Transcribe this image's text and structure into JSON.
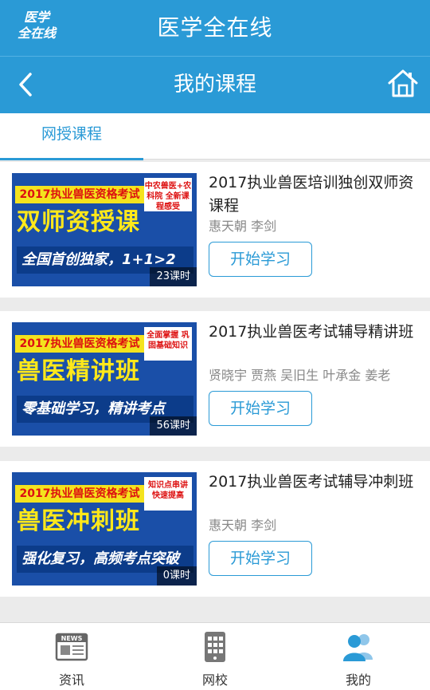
{
  "app": {
    "logo_line1": "医学",
    "logo_line2": "全在线",
    "title": "医学全在线"
  },
  "nav": {
    "title": "我的课程",
    "back_icon": "chevron-left-icon",
    "home_icon": "home-icon"
  },
  "tabs": [
    {
      "label": "网授课程",
      "active": true
    }
  ],
  "colors": {
    "primary": "#2a9ad6",
    "background": "#ebebeb",
    "thumb_blue": "#1a4fa8",
    "thumb_yellow": "#ffe81a"
  },
  "courses": [
    {
      "title": "2017执业兽医培训独创双师资课程",
      "teachers": "惠天朝 李剑",
      "hours": "23课时",
      "button": "开始学习",
      "thumb": {
        "top": "2017执业兽医资格考试",
        "main": "双师资授课",
        "badge": "中农兽医+农科院 全新课程感受",
        "bottom": "全国首创独家，1+1>2"
      }
    },
    {
      "title": "2017执业兽医考试辅导精讲班",
      "teachers": "贤晓宇 贾燕 吴旧生 叶承金 姜老",
      "hours": "56课时",
      "button": "开始学习",
      "thumb": {
        "top": "2017执业兽医资格考试",
        "main": "兽医精讲班",
        "badge": "全面掌握 巩固基础知识",
        "bottom": "零基础学习，精讲考点"
      }
    },
    {
      "title": "2017执业兽医考试辅导冲刺班",
      "teachers": "惠天朝 李剑",
      "hours": "0课时",
      "button": "开始学习",
      "thumb": {
        "top": "2017执业兽医资格考试",
        "main": "兽医冲刺班",
        "badge": "知识点串讲 快速提高",
        "bottom": "强化复习，高频考点突破"
      }
    }
  ],
  "bottom_nav": [
    {
      "label": "资讯",
      "icon": "news-icon"
    },
    {
      "label": "网校",
      "icon": "school-grid-icon"
    },
    {
      "label": "我的",
      "icon": "users-icon",
      "active": true
    }
  ]
}
